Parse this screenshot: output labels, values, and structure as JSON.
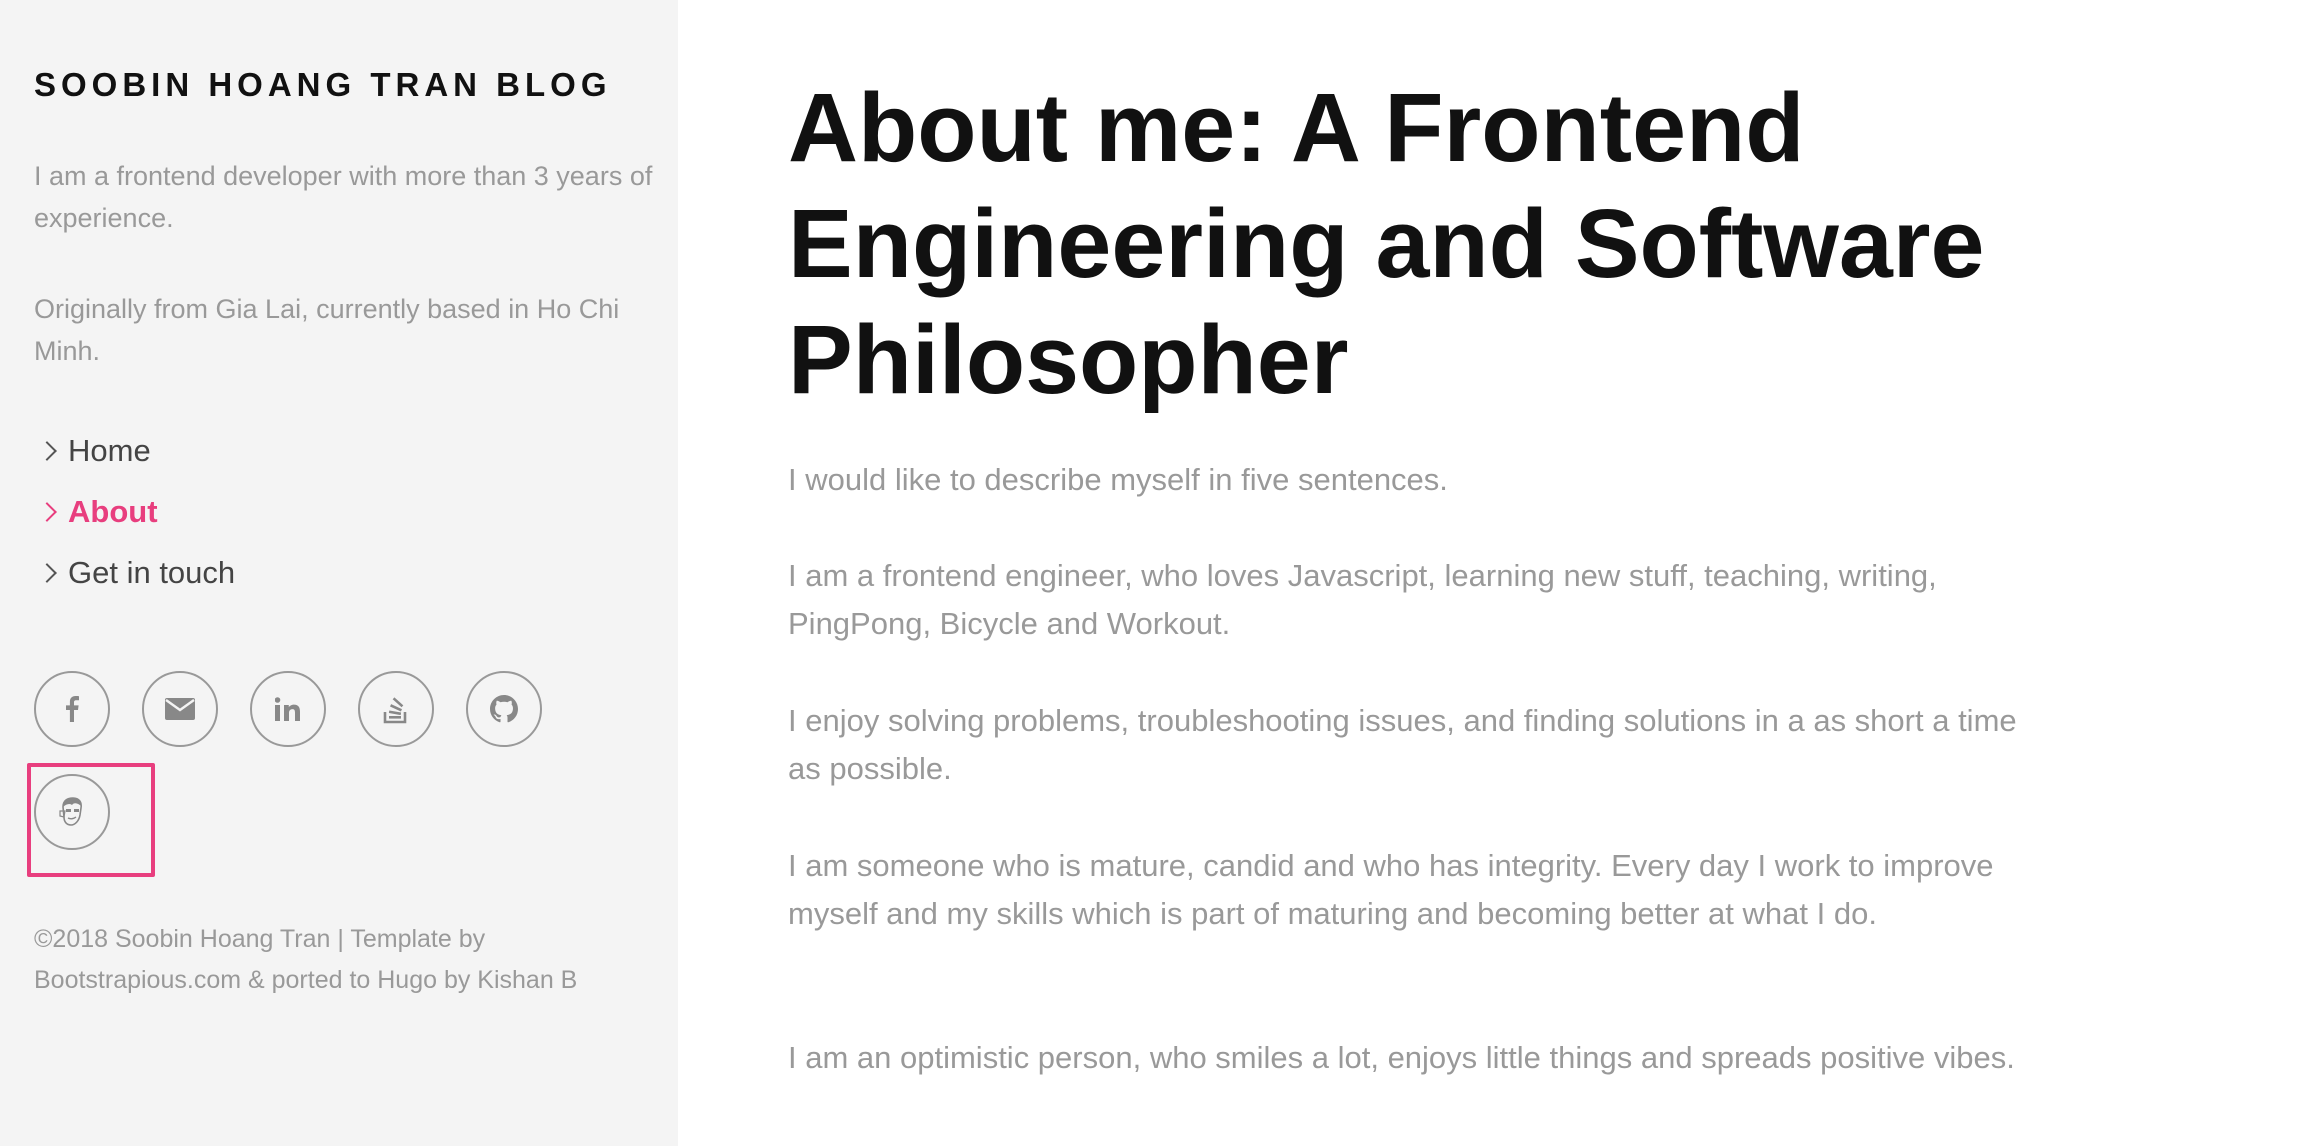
{
  "sidebar": {
    "site_title": "SOOBIN HOANG TRAN BLOG",
    "intro": [
      "I am a frontend developer with more than 3 years of experience.",
      "Originally from Gia Lai, currently based in Ho Chi Minh."
    ],
    "nav": [
      {
        "label": "Home",
        "active": false
      },
      {
        "label": "About",
        "active": true
      },
      {
        "label": "Get in touch",
        "active": false
      }
    ],
    "social_icons": [
      "facebook-icon",
      "email-icon",
      "linkedin-icon",
      "stackoverflow-icon",
      "github-icon",
      "avatar-icon"
    ],
    "footer": "©2018 Soobin Hoang Tran | Template by Bootstrapious.com & ported to Hugo by Kishan B"
  },
  "main": {
    "title": "About me: A Frontend Engineering and Software Philosopher",
    "paragraphs": [
      "I would like to describe myself in five sentences.",
      "I am a frontend engineer, who loves Javascript, learning new stuff, teaching, writing, PingPong, Bicycle and Workout.",
      "I enjoy solving problems, troubleshooting issues, and finding solutions in a as short a time as possible.",
      "I am someone who is mature, candid and who has integrity. Every day I work to improve myself and my skills which is part of maturing and becoming better at what I do.",
      "I am an optimistic person, who smiles a lot, enjoys little things and spreads positive vibes."
    ]
  },
  "colors": {
    "accent": "#e83e7e",
    "sidebar_bg": "#f4f4f4",
    "muted_text": "#999999",
    "heading_text": "#111111"
  }
}
